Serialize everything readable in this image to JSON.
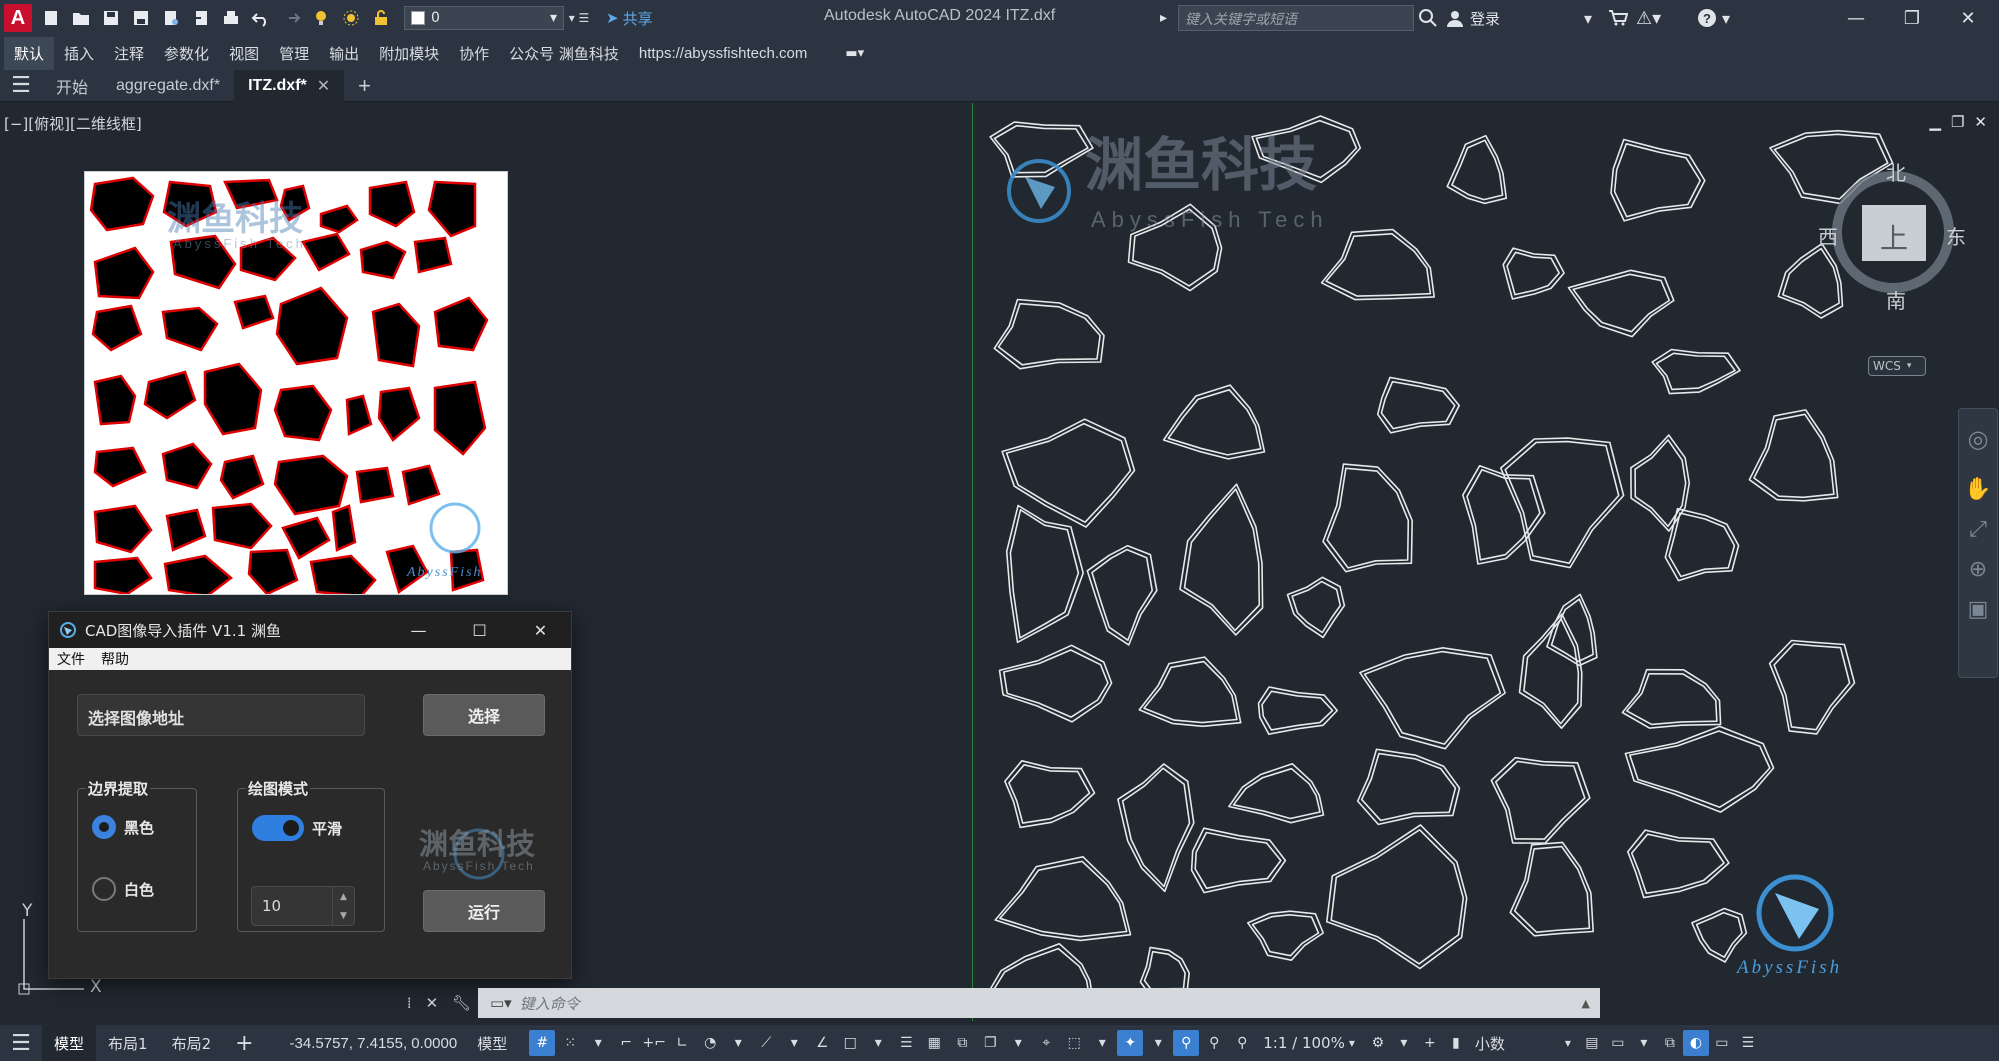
{
  "titlebar": {
    "app_logo": "A",
    "layer_value": "0",
    "share_label": "共享",
    "title": "Autodesk AutoCAD 2024    ITZ.dxf",
    "search_placeholder": "键入关键字或短语",
    "login_label": "登录"
  },
  "ribbon": {
    "tabs": [
      "默认",
      "插入",
      "注释",
      "参数化",
      "视图",
      "管理",
      "输出",
      "附加模块",
      "协作",
      "公众号 渊鱼科技"
    ],
    "url": "https://abyssfishtech.com"
  },
  "filetabs": {
    "start": "开始",
    "tabs": [
      "aggregate.dxf*",
      "ITZ.dxf*"
    ],
    "close": "✕",
    "add": "+"
  },
  "viewport": {
    "label": "[−][俯视][二维线框]",
    "watermark_cn": "渊鱼科技",
    "watermark_en": "AbyssFish Tech",
    "corner_logo_text": "AbyssFish"
  },
  "viewcube": {
    "north": "北",
    "south": "南",
    "east": "东",
    "west": "西",
    "top": "上",
    "wcs": "WCS"
  },
  "ucs": {
    "y": "Y",
    "x": "X"
  },
  "dialog": {
    "title": "CAD图像导入插件 V1.1 渊鱼",
    "menu": [
      "文件",
      "帮助"
    ],
    "path_placeholder": "选择图像地址",
    "select_button": "选择",
    "boundary_group": "边界提取",
    "black_option": "黑色",
    "white_option": "白色",
    "draw_mode_group": "绘图模式",
    "smooth_label": "平滑",
    "smooth_value": "10",
    "run_button": "运行",
    "logo_cn": "渊鱼科技",
    "logo_en": "AbyssFish Tech"
  },
  "command": {
    "placeholder": "键入命令"
  },
  "statusbar": {
    "tabs": [
      "模型",
      "布局1",
      "布局2"
    ],
    "coords": "-34.5757, 7.4155, 0.0000",
    "model_label": "模型",
    "scale": "1:1 / 100%",
    "units": "小数"
  },
  "colors": {
    "background": "#212830",
    "chrome": "#2b3440",
    "accent": "#3a7fd0",
    "outline": "#e8e8e8",
    "preview_edge": "#e00000"
  }
}
